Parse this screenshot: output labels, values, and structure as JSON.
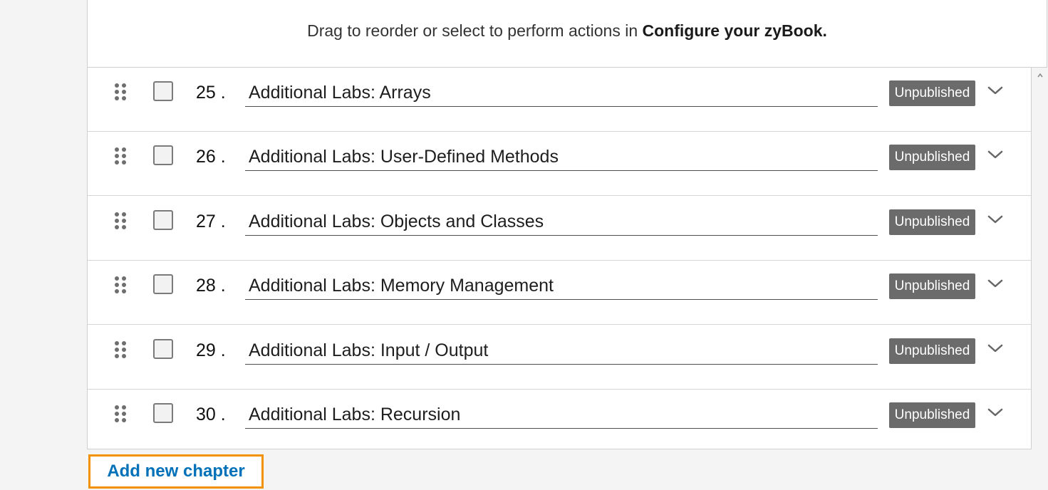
{
  "header": {
    "instruction_prefix": "Drag to reorder or select to perform actions in ",
    "instruction_strong": "Configure your zyBook."
  },
  "chapters": [
    {
      "number": "25 .",
      "title": "Additional Labs: Arrays",
      "status": "Unpublished"
    },
    {
      "number": "26 .",
      "title": "Additional Labs: User-Defined Methods",
      "status": "Unpublished"
    },
    {
      "number": "27 .",
      "title": "Additional Labs: Objects and Classes",
      "status": "Unpublished"
    },
    {
      "number": "28 .",
      "title": "Additional Labs: Memory Management",
      "status": "Unpublished"
    },
    {
      "number": "29 .",
      "title": "Additional Labs: Input / Output",
      "status": "Unpublished"
    },
    {
      "number": "30 .",
      "title": "Additional Labs: Recursion",
      "status": "Unpublished"
    }
  ],
  "actions": {
    "add_chapter_label": "Add new chapter"
  },
  "icons": {
    "drag": "drag-handle-icon",
    "expand": "chevron-down-icon",
    "scroll": "scroll-up-arrow-icon"
  },
  "colors": {
    "badge_bg": "#6b6b6b",
    "link": "#0071b8",
    "focus_outline": "#f39200"
  }
}
